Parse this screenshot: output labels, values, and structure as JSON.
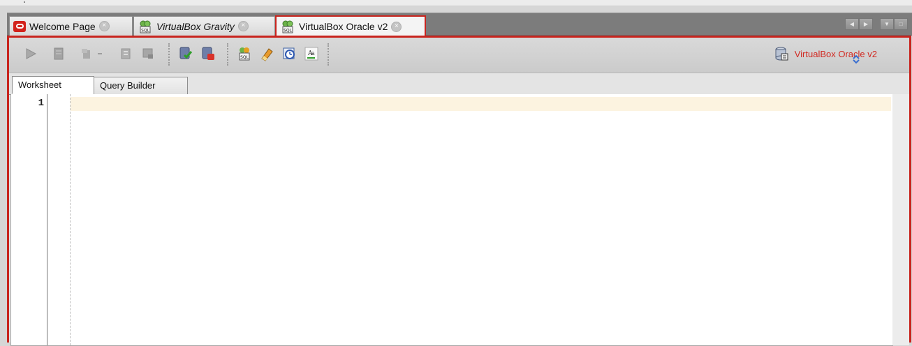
{
  "tabs": [
    {
      "label": "Welcome Page",
      "icon": "oracle-icon",
      "italic": false,
      "active": false
    },
    {
      "label": "VirtualBox Gravity",
      "icon": "sql-worksheet-icon",
      "italic": true,
      "active": false
    },
    {
      "label": "VirtualBox Oracle v2",
      "icon": "sql-worksheet-icon",
      "italic": false,
      "active": true
    }
  ],
  "toolbar": {
    "connection_name": "VirtualBox Oracle v2",
    "buttons": [
      "run-statement",
      "run-script",
      "autotrace",
      "explain-plan",
      "sql-tuning",
      "commit",
      "rollback",
      "unshared-sql",
      "clear",
      "sql-history",
      "format"
    ]
  },
  "sheet_tabs": [
    "Worksheet",
    "Query Builder"
  ],
  "editor": {
    "line_numbers": [
      "1"
    ]
  },
  "colors": {
    "accent": "#c8241e",
    "connection_text": "#d12a22",
    "current_line": "#fcf3e0"
  }
}
